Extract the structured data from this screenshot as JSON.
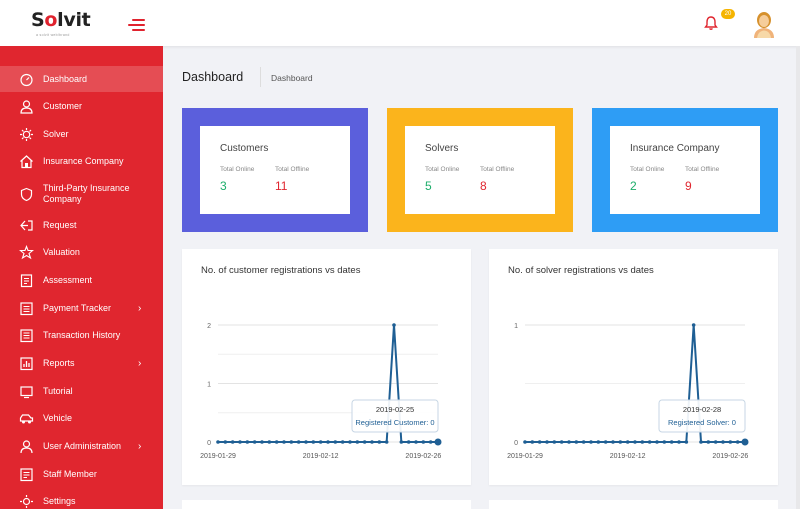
{
  "app": {
    "brand": "Solvit",
    "tagline": "a solvit web/brand"
  },
  "header": {
    "notification_count": "20"
  },
  "sidebar": {
    "items": [
      {
        "label": "Dashboard",
        "icon": "dashboard-icon",
        "active": true
      },
      {
        "label": "Customer",
        "icon": "user-icon"
      },
      {
        "label": "Solver",
        "icon": "gear-icon"
      },
      {
        "label": "Insurance Company",
        "icon": "home-icon"
      },
      {
        "label": "Third-Party Insurance Company",
        "icon": "shield-icon"
      },
      {
        "label": "Request",
        "icon": "request-icon"
      },
      {
        "label": "Valuation",
        "icon": "valuation-icon"
      },
      {
        "label": "Assessment",
        "icon": "assessment-icon"
      },
      {
        "label": "Payment Tracker",
        "icon": "payment-icon",
        "has_submenu": true
      },
      {
        "label": "Transaction History",
        "icon": "history-icon"
      },
      {
        "label": "Reports",
        "icon": "reports-icon",
        "has_submenu": true
      },
      {
        "label": "Tutorial",
        "icon": "tutorial-icon"
      },
      {
        "label": "Vehicle",
        "icon": "vehicle-icon"
      },
      {
        "label": "User Administration",
        "icon": "admin-icon",
        "has_submenu": true
      },
      {
        "label": "Staff Member",
        "icon": "staff-icon"
      },
      {
        "label": "Settings",
        "icon": "settings-icon"
      }
    ]
  },
  "page": {
    "title": "Dashboard",
    "breadcrumb": "Dashboard"
  },
  "stats": [
    {
      "title": "Customers",
      "online_label": "Total Online",
      "offline_label": "Total Offline",
      "online": "3",
      "offline": "11",
      "color": "#5b5fdc"
    },
    {
      "title": "Solvers",
      "online_label": "Total Online",
      "offline_label": "Total Offline",
      "online": "5",
      "offline": "8",
      "color": "#fbb41c"
    },
    {
      "title": "Insurance Company",
      "online_label": "Total Online",
      "offline_label": "Total Offline",
      "online": "2",
      "offline": "9",
      "color": "#2e9df5"
    }
  ],
  "charts": [
    {
      "title": "No. of customer registrations vs dates",
      "tooltip_date": "2019-02-25",
      "tooltip_text": "Registered Customer: 0"
    },
    {
      "title": "No. of solver registrations vs dates",
      "tooltip_date": "2019-02-28",
      "tooltip_text": "Registered Solver: 0"
    }
  ],
  "chart_data": [
    {
      "type": "line",
      "title": "No. of customer registrations vs dates",
      "x_tick_labels": [
        "2019-01-29",
        "2019-02-12",
        "2019-02-26"
      ],
      "y_tick_labels": [
        "0",
        "1",
        "2"
      ],
      "ylim": [
        0,
        2
      ],
      "x": [
        "2019-01-29",
        "2019-01-30",
        "2019-01-31",
        "2019-02-01",
        "2019-02-02",
        "2019-02-03",
        "2019-02-04",
        "2019-02-05",
        "2019-02-06",
        "2019-02-07",
        "2019-02-08",
        "2019-02-09",
        "2019-02-10",
        "2019-02-11",
        "2019-02-12",
        "2019-02-13",
        "2019-02-14",
        "2019-02-15",
        "2019-02-16",
        "2019-02-17",
        "2019-02-18",
        "2019-02-19",
        "2019-02-20",
        "2019-02-21",
        "2019-02-22",
        "2019-02-23",
        "2019-02-24",
        "2019-02-25",
        "2019-02-26",
        "2019-02-27",
        "2019-02-28"
      ],
      "series": [
        {
          "values": [
            0,
            0,
            0,
            0,
            0,
            0,
            0,
            0,
            0,
            0,
            0,
            0,
            0,
            0,
            0,
            0,
            0,
            0,
            0,
            0,
            0,
            0,
            0,
            0,
            2,
            0,
            0,
            0,
            0,
            0,
            0
          ]
        }
      ],
      "grid": true,
      "color": "#1f5f94"
    },
    {
      "type": "line",
      "title": "No. of solver registrations vs dates",
      "x_tick_labels": [
        "2019-01-29",
        "2019-02-12",
        "2019-02-26"
      ],
      "y_tick_labels": [
        "0",
        "1"
      ],
      "ylim": [
        0,
        1
      ],
      "x": [
        "2019-01-29",
        "2019-01-30",
        "2019-01-31",
        "2019-02-01",
        "2019-02-02",
        "2019-02-03",
        "2019-02-04",
        "2019-02-05",
        "2019-02-06",
        "2019-02-07",
        "2019-02-08",
        "2019-02-09",
        "2019-02-10",
        "2019-02-11",
        "2019-02-12",
        "2019-02-13",
        "2019-02-14",
        "2019-02-15",
        "2019-02-16",
        "2019-02-17",
        "2019-02-18",
        "2019-02-19",
        "2019-02-20",
        "2019-02-21",
        "2019-02-22",
        "2019-02-23",
        "2019-02-24",
        "2019-02-25",
        "2019-02-26",
        "2019-02-27",
        "2019-02-28"
      ],
      "series": [
        {
          "values": [
            0,
            0,
            0,
            0,
            0,
            0,
            0,
            0,
            0,
            0,
            0,
            0,
            0,
            0,
            0,
            0,
            0,
            0,
            0,
            0,
            0,
            0,
            0,
            1,
            0,
            0,
            0,
            0,
            0,
            0,
            0
          ]
        }
      ],
      "grid": true,
      "color": "#1f5f94"
    }
  ]
}
